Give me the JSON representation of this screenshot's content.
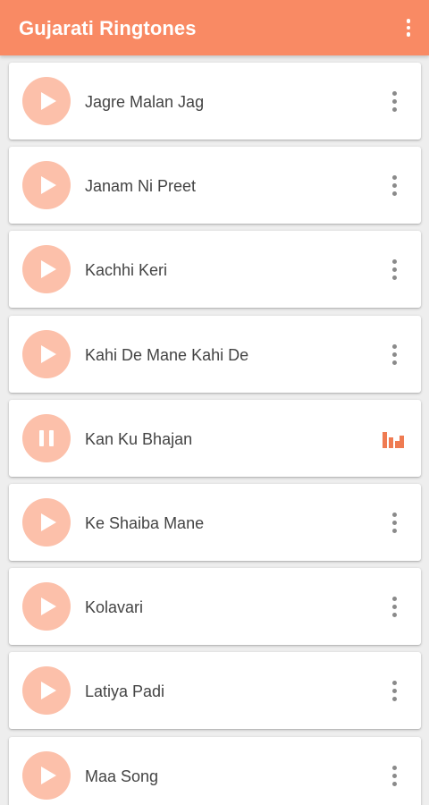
{
  "appbar": {
    "title": "Gujarati Ringtones",
    "overflow_icon": "more-vert-icon"
  },
  "theme": {
    "primary": "#f98a64",
    "play_button": "#fcc0aa",
    "equalizer": "#ef7b52",
    "background": "#eeeeee"
  },
  "songs": [
    {
      "title": "Jagre Malan Jag",
      "state": "stopped",
      "button_icon": "play-icon",
      "trailing_icon": "more-vert-icon"
    },
    {
      "title": "Janam Ni Preet",
      "state": "stopped",
      "button_icon": "play-icon",
      "trailing_icon": "more-vert-icon"
    },
    {
      "title": "Kachhi Keri",
      "state": "stopped",
      "button_icon": "play-icon",
      "trailing_icon": "more-vert-icon"
    },
    {
      "title": "Kahi De Mane Kahi De",
      "state": "stopped",
      "button_icon": "play-icon",
      "trailing_icon": "more-vert-icon"
    },
    {
      "title": "Kan Ku Bhajan",
      "state": "playing",
      "button_icon": "pause-icon",
      "trailing_icon": "equalizer-icon"
    },
    {
      "title": "Ke Shaiba Mane",
      "state": "stopped",
      "button_icon": "play-icon",
      "trailing_icon": "more-vert-icon"
    },
    {
      "title": "Kolavari",
      "state": "stopped",
      "button_icon": "play-icon",
      "trailing_icon": "more-vert-icon"
    },
    {
      "title": "Latiya Padi",
      "state": "stopped",
      "button_icon": "play-icon",
      "trailing_icon": "more-vert-icon"
    },
    {
      "title": "Maa Song",
      "state": "stopped",
      "button_icon": "play-icon",
      "trailing_icon": "more-vert-icon"
    }
  ]
}
